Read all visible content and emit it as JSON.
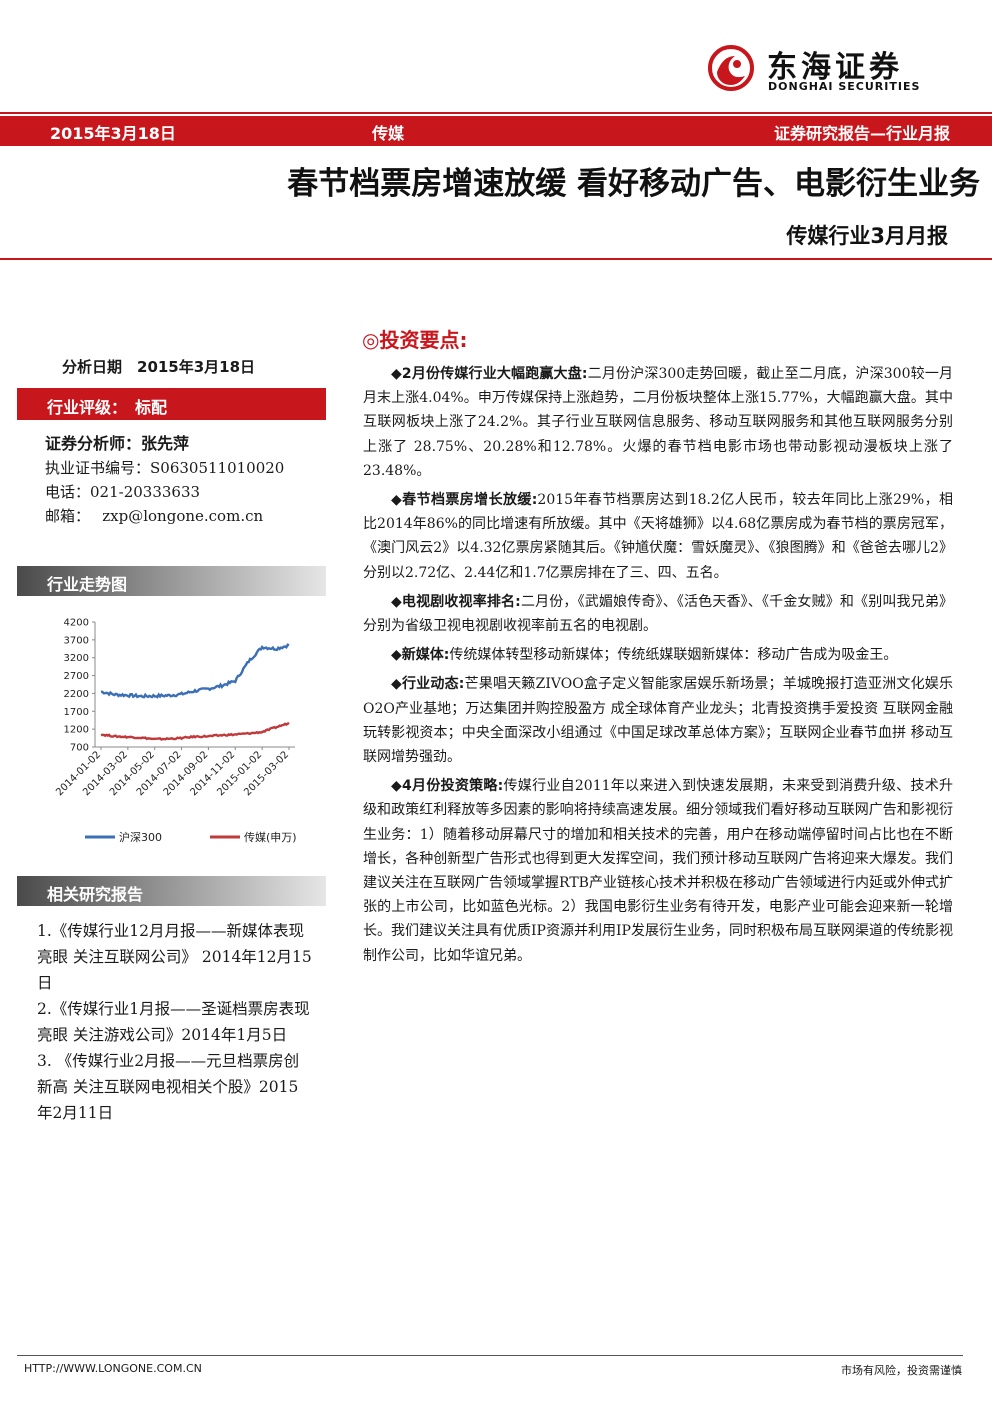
{
  "brand": {
    "name_cn": "东海证券",
    "name_en": "DONGHAI SECURITIES"
  },
  "header": {
    "date": "2015年3月18日",
    "industry": "传媒",
    "report_type": "证券研究报告—行业月报"
  },
  "title": {
    "main": "春节档票房增速放缓 看好移动广告、电影衍生业务",
    "sub": "传媒行业3月月报"
  },
  "sidebar": {
    "analysis_date": "分析日期　2015年3月18日",
    "rating": "行业评级：　标配",
    "analyst_name": "证券分析师：张先萍",
    "cert": "执业证书编号：S0630511010020",
    "phone": "电话：021-20333633",
    "email": "邮箱：　 zxp@longone.com.cn",
    "trend_title": "行业走势图",
    "related_title": "相关研究报告",
    "reports": [
      "1.《传媒行业12月月报——新媒体表现亮眼 关注互联网公司》 2014年12月15日",
      "2.《传媒行业1月报——圣诞档票房表现亮眼 关注游戏公司》2014年1月5日",
      "3. 《传媒行业2月报——元旦档票房创新高 关注互联网电视相关个股》2015年2月11日"
    ]
  },
  "chart_data": {
    "type": "line",
    "title": "",
    "xlabel": "",
    "ylabel": "",
    "ylim": [
      700,
      4200
    ],
    "yticks": [
      "4200",
      "3700",
      "3200",
      "2700",
      "2200",
      "1700",
      "1200",
      "700"
    ],
    "x_ticks": [
      "2014-01-02",
      "2014-03-02",
      "2014-05-02",
      "2014-07-02",
      "2014-09-02",
      "2014-11-02",
      "2015-01-02",
      "2015-03-02"
    ],
    "x": [
      "2014-01",
      "2014-02",
      "2014-03",
      "2014-04",
      "2014-05",
      "2014-06",
      "2014-07",
      "2014-08",
      "2014-09",
      "2014-10",
      "2014-11",
      "2014-12",
      "2015-01",
      "2015-02",
      "2015-03"
    ],
    "legend_position": "bottom",
    "grid": false,
    "series": [
      {
        "name": "沪深300",
        "color": "#3b6fb6",
        "values": [
          2250,
          2170,
          2150,
          2120,
          2130,
          2140,
          2180,
          2270,
          2330,
          2420,
          2550,
          3100,
          3500,
          3450,
          3550
        ]
      },
      {
        "name": "传媒(申万)",
        "color": "#c0393b",
        "values": [
          1050,
          1000,
          980,
          960,
          920,
          930,
          950,
          990,
          1000,
          1030,
          1050,
          1080,
          1120,
          1250,
          1370
        ]
      }
    ]
  },
  "investment": {
    "heading": "◎投资要点:",
    "items": [
      {
        "bold": "◆2月份传媒行业大幅跑赢大盘:",
        "text": "二月份沪深300走势回暖，截止至二月底，沪深300较一月月末上涨4.04%。申万传媒保持上涨趋势，二月份板块整体上涨15.77%，大幅跑赢大盘。其中互联网板块上涨了24.2%。其子行业互联网信息服务、移动互联网服务和其他互联网服务分别上涨了 28.75%、20.28%和12.78%。火爆的春节档电影市场也带动影视动漫板块上涨了23.48%。"
      },
      {
        "bold": "◆春节档票房增长放缓:",
        "text": "2015年春节档票房达到18.2亿人民币，较去年同比上涨29%，相比2014年86%的同比增速有所放缓。其中《天将雄狮》以4.68亿票房成为春节档的票房冠军，《澳门风云2》以4.32亿票房紧随其后。《钟馗伏魔：雪妖魔灵》、《狼图腾》和《爸爸去哪儿2》分别以2.72亿、2.44亿和1.7亿票房排在了三、四、五名。"
      },
      {
        "bold": "◆电视剧收视率排名:",
        "text": "二月份，《武媚娘传奇》、《活色天香》、《千金女贼》和《别叫我兄弟》分别为省级卫视电视剧收视率前五名的电视剧。"
      },
      {
        "bold": "◆新媒体:",
        "text": "传统媒体转型移动新媒体；传统纸媒联姻新媒体：移动广告成为吸金王。"
      },
      {
        "bold": "◆行业动态:",
        "text": "芒果唱天籁ZIVOO盒子定义智能家居娱乐新场景；羊城晚报打造亚洲文化娱乐O2O产业基地；万达集团并购控股盈方 成全球体育产业龙头；北青投资携手爱投资 互联网金融玩转影视资本；中央全面深改小组通过《中国足球改革总体方案》；互联网企业春节血拼 移动互联网增势强劲。"
      },
      {
        "bold": "◆4月份投资策略:",
        "text": "传媒行业自2011年以来进入到快速发展期，未来受到消费升级、技术升级和政策红利释放等多因素的影响将持续高速发展。细分领域我们看好移动互联网广告和影视衍生业务：1）随着移动屏幕尺寸的增加和相关技术的完善，用户在移动端停留时间占比也在不断增长，各种创新型广告形式也得到更大发挥空间，我们预计移动互联网广告将迎来大爆发。我们建议关注在互联网广告领域掌握RTB产业链核心技术并积极在移动广告领域进行内延或外伸式扩张的上市公司，比如蓝色光标。2）我国电影衍生业务有待开发，电影产业可能会迎来新一轮增长。我们建议关注具有优质IP资源并利用IP发展衍生业务，同时积极布局互联网渠道的传统影视制作公司，比如华谊兄弟。"
      }
    ]
  },
  "footer": {
    "url": "HTTP://WWW.LONGONE.COM.CN",
    "disclaimer": "市场有风险，投资需谨慎"
  }
}
